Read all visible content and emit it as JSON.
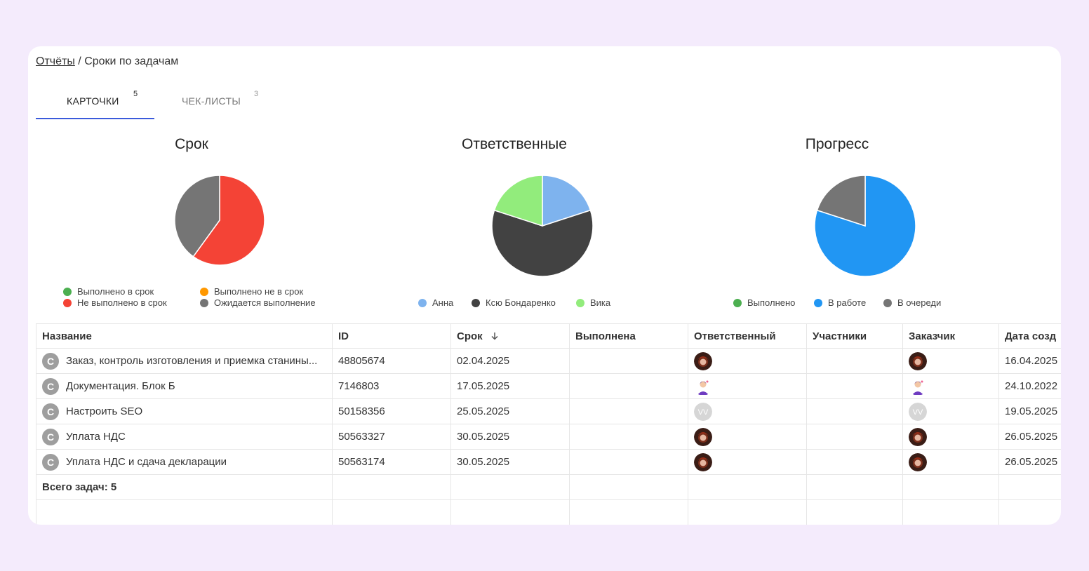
{
  "breadcrumb": {
    "link": "Отчёты",
    "separator": " / ",
    "current": "Сроки по задачам"
  },
  "tabs": [
    {
      "label": "Карточки",
      "count": "5"
    },
    {
      "label": "Чек-листы",
      "count": "3"
    }
  ],
  "chart_data": [
    {
      "type": "pie",
      "title": "Срок",
      "labels": [
        "Выполнено в срок",
        "Не выполнено в срок",
        "Выполнено не в срок",
        "Ожидается выполнение"
      ],
      "values": [
        0,
        3,
        0,
        2
      ],
      "colors": [
        "#4caf50",
        "#f44336",
        "#ff9800",
        "#757575"
      ],
      "legend_placement": "bottom"
    },
    {
      "type": "pie",
      "title": "Ответственные",
      "labels": [
        "Анна",
        "Ксю Бондаренко",
        "Вика"
      ],
      "values": [
        1,
        3,
        1
      ],
      "colors": [
        "#7eb3ee",
        "#424242",
        "#92ec7c"
      ],
      "legend_placement": "bottom"
    },
    {
      "type": "pie",
      "title": "Прогресс",
      "labels": [
        "Выполнено",
        "В работе",
        "В очереди"
      ],
      "values": [
        0,
        4,
        1
      ],
      "colors": [
        "#4caf50",
        "#2196f3",
        "#757575"
      ],
      "legend_placement": "bottom"
    }
  ],
  "table": {
    "headers": [
      "Название",
      "ID",
      "Срок",
      "Выполнена",
      "Ответственный",
      "Участники",
      "Заказчик",
      "Дата созд"
    ],
    "sort_icon": "arrow-down-icon",
    "row_icon_letter": "С",
    "rows": [
      {
        "name": "Заказ, контроль изготовления и приемка станины...",
        "id": "48805674",
        "due": "02.04.2025",
        "done": "",
        "assignee": "avatar-redhead",
        "participants": "",
        "customer": "avatar-redhead",
        "created": "16.04.2025"
      },
      {
        "name": "Документация. Блок Б",
        "id": "7146803",
        "due": "17.05.2025",
        "done": "",
        "assignee": "avatar-illustrated",
        "participants": "",
        "customer": "avatar-illustrated",
        "created": "24.10.2022"
      },
      {
        "name": "Настроить SEO",
        "id": "50158356",
        "due": "25.05.2025",
        "done": "",
        "assignee": "avatar-initials-vv",
        "participants": "",
        "customer": "avatar-initials-vv",
        "created": "19.05.2025"
      },
      {
        "name": "Уплата НДС",
        "id": "50563327",
        "due": "30.05.2025",
        "done": "",
        "assignee": "avatar-redhead",
        "participants": "",
        "customer": "avatar-redhead",
        "created": "26.05.2025"
      },
      {
        "name": "Уплата НДС и сдача декларации",
        "id": "50563174",
        "due": "30.05.2025",
        "done": "",
        "assignee": "avatar-redhead",
        "participants": "",
        "customer": "avatar-redhead",
        "created": "26.05.2025"
      }
    ],
    "total": "Всего задач: 5"
  }
}
